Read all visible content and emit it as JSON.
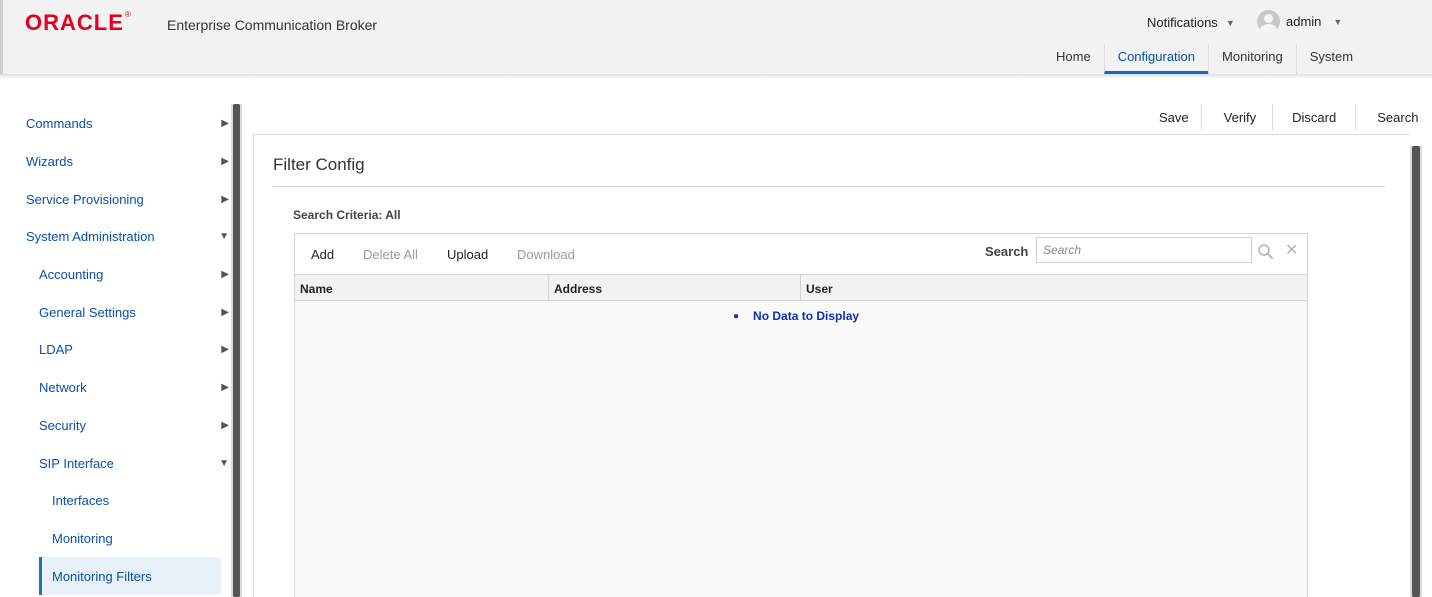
{
  "header": {
    "logo_text": "ORACLE",
    "logo_mark": "®",
    "app_title": "Enterprise Communication Broker",
    "notifications_label": "Notifications",
    "user_name": "admin",
    "tabs": [
      {
        "label": "Home"
      },
      {
        "label": "Configuration"
      },
      {
        "label": "Monitoring"
      },
      {
        "label": "System"
      }
    ],
    "active_tab": "Configuration"
  },
  "sidebar": {
    "items": [
      {
        "label": "Commands",
        "arrow": "▶"
      },
      {
        "label": "Wizards",
        "arrow": "▶"
      },
      {
        "label": "Service Provisioning",
        "arrow": "▶"
      },
      {
        "label": "System Administration",
        "arrow": "▼"
      },
      {
        "label": "Accounting",
        "arrow": "▶"
      },
      {
        "label": "General Settings",
        "arrow": "▶"
      },
      {
        "label": "LDAP",
        "arrow": "▶"
      },
      {
        "label": "Network",
        "arrow": "▶"
      },
      {
        "label": "Security",
        "arrow": "▶"
      },
      {
        "label": "SIP Interface",
        "arrow": "▼"
      },
      {
        "label": "Interfaces"
      },
      {
        "label": "Monitoring"
      },
      {
        "label": "Monitoring Filters"
      }
    ],
    "active_item": "Monitoring Filters"
  },
  "actions": {
    "save": "Save",
    "verify": "Verify",
    "discard": "Discard",
    "search": "Search"
  },
  "panel": {
    "title": "Filter Config",
    "criteria": "Search Criteria: All",
    "toolbar": {
      "add": "Add",
      "delete_all": "Delete All",
      "upload": "Upload",
      "download": "Download",
      "search_label": "Search",
      "search_placeholder": "Search",
      "search_icon": "magnifier-icon",
      "clear_icon": "close-icon"
    },
    "columns": [
      "Name",
      "Address",
      "User"
    ],
    "empty_message": "No Data to Display"
  },
  "colors": {
    "brand": "#e3001b",
    "link": "#0b4fa8",
    "active_tab_underline": "#0b6ec6",
    "empty_message": "#0b2fb8"
  }
}
